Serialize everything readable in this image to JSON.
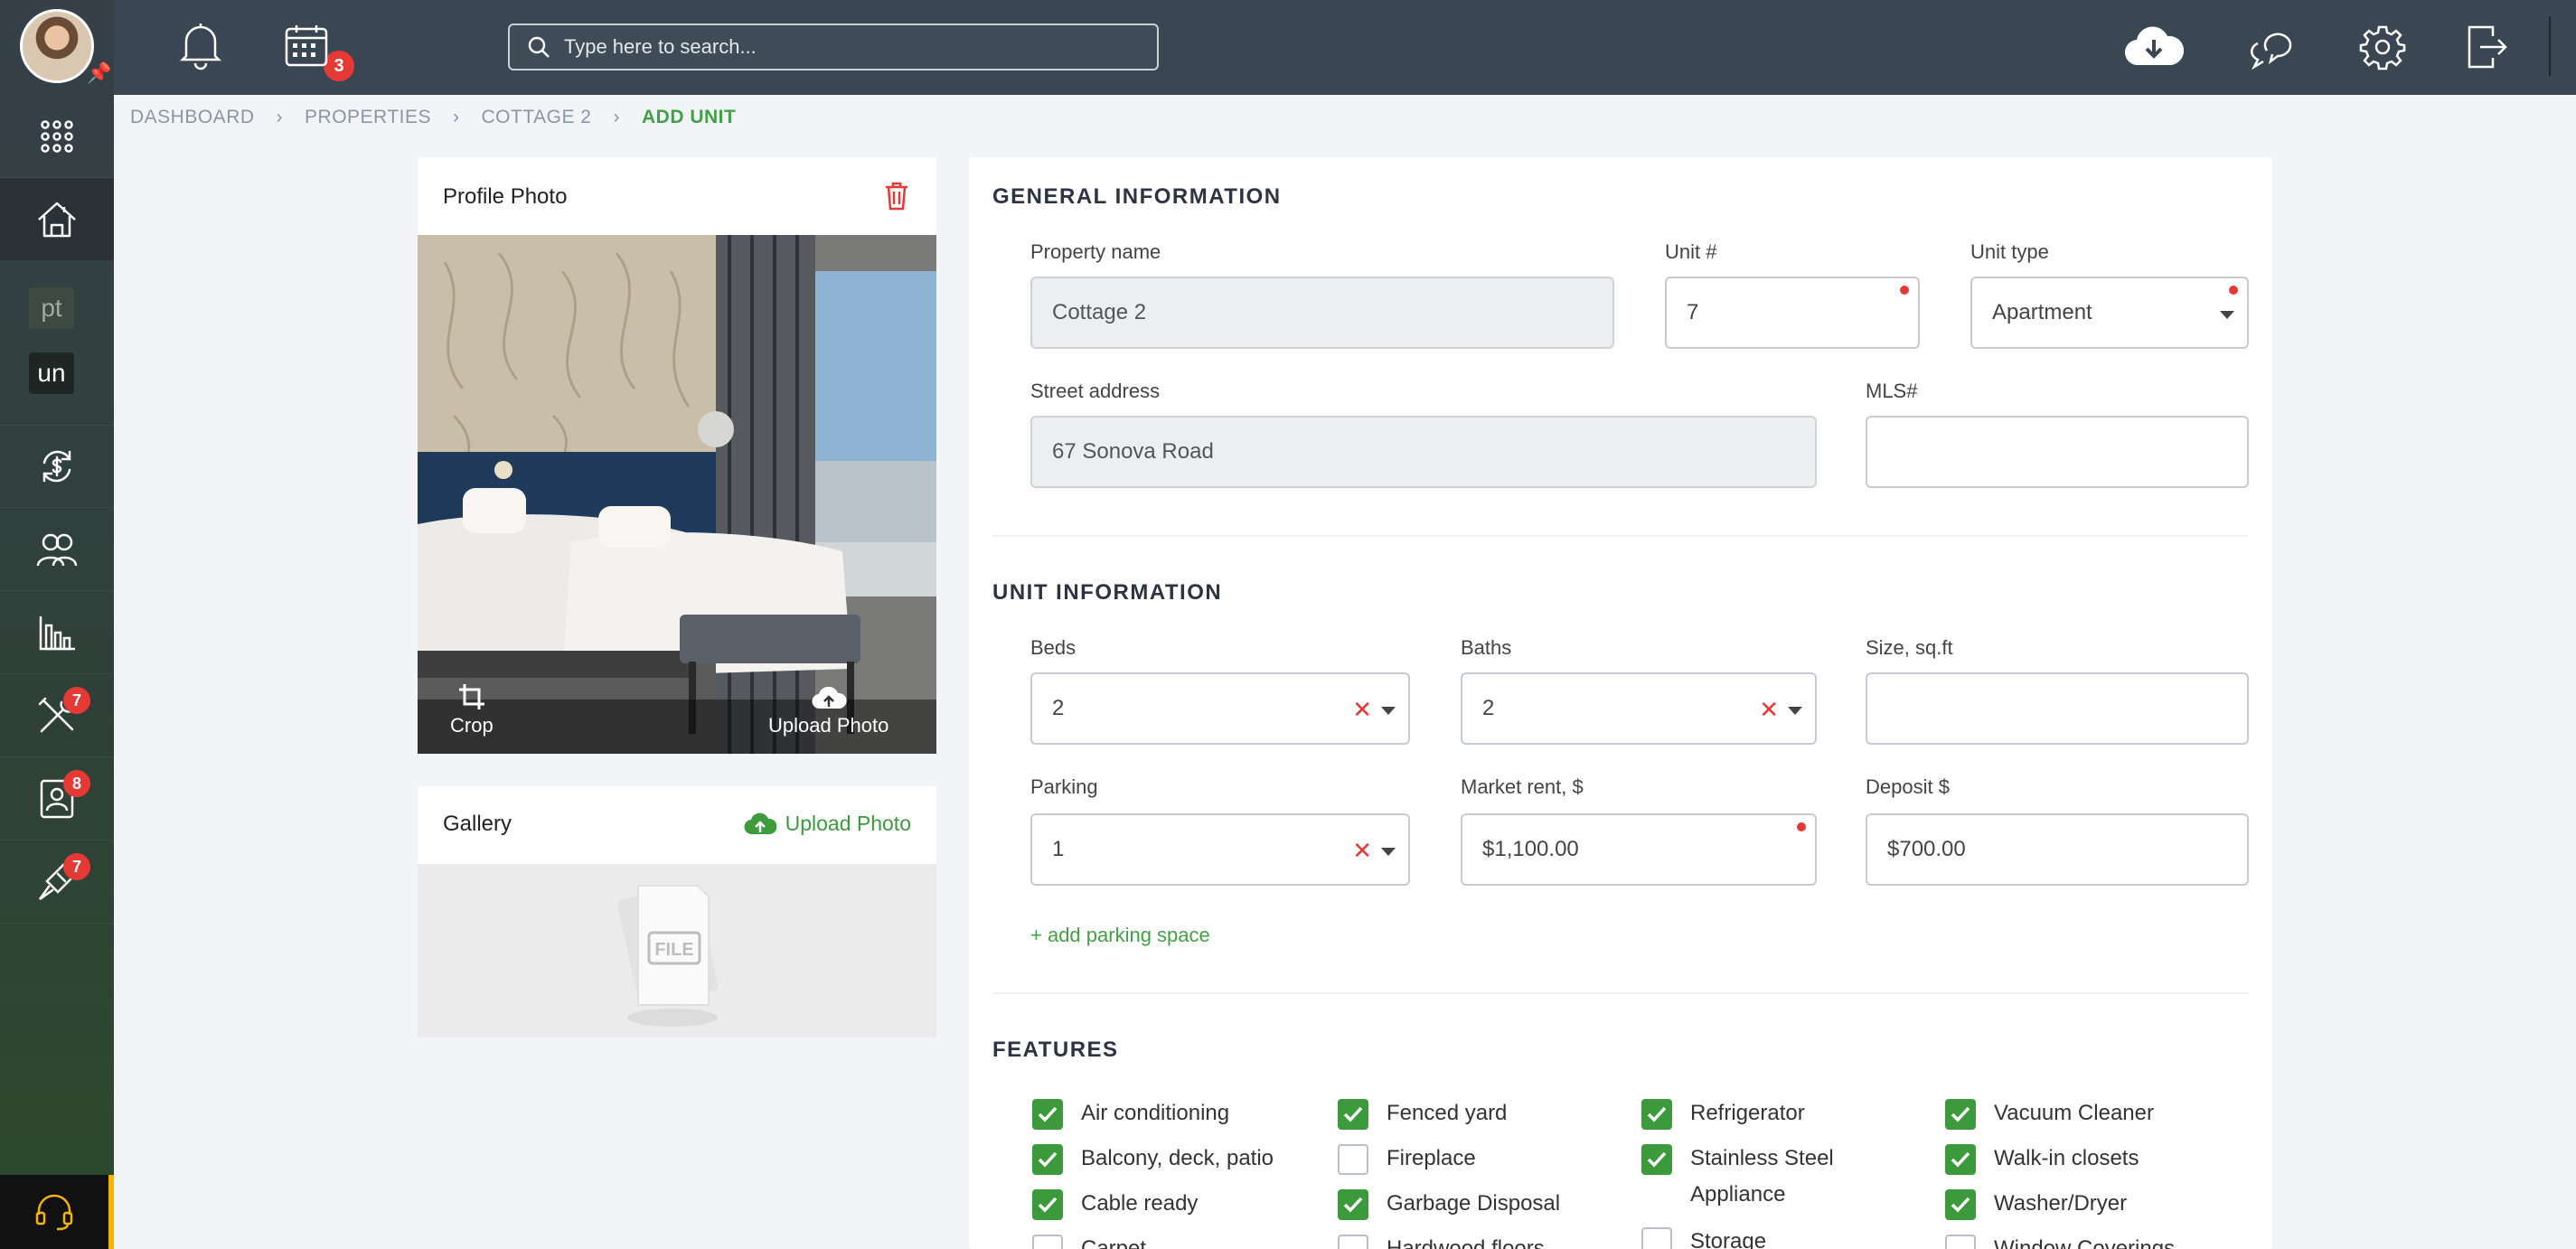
{
  "topbar": {
    "notifications_count": "3",
    "search_placeholder": "Type here to search..."
  },
  "sidebar": {
    "pt_label": "pt",
    "un_label": "un",
    "tools_badge": "7",
    "tenants_badge": "8",
    "maintenance_badge": "7"
  },
  "breadcrumb": [
    "DASHBOARD",
    "PROPERTIES",
    "COTTAGE 2",
    "ADD UNIT"
  ],
  "profile_photo": {
    "title": "Profile Photo",
    "crop_label": "Crop",
    "upload_label": "Upload Photo"
  },
  "gallery": {
    "title": "Gallery",
    "upload_label": "Upload Photo",
    "file_label": "FILE"
  },
  "general": {
    "title": "GENERAL INFORMATION",
    "property_name_label": "Property name",
    "property_name_value": "Cottage 2",
    "unit_label": "Unit #",
    "unit_value": "7",
    "unit_type_label": "Unit type",
    "unit_type_value": "Apartment",
    "street_label": "Street address",
    "street_value": "67 Sonova Road",
    "mls_label": "MLS#",
    "mls_value": ""
  },
  "unit_info": {
    "title": "UNIT INFORMATION",
    "beds_label": "Beds",
    "beds_value": "2",
    "baths_label": "Baths",
    "baths_value": "2",
    "size_label": "Size, sq.ft",
    "size_value": "",
    "parking_label": "Parking",
    "parking_value": "1",
    "rent_label": "Market rent, $",
    "rent_value": "$1,100.00",
    "deposit_label": "Deposit $",
    "deposit_value": "$700.00",
    "add_parking": "+ add parking space"
  },
  "features": {
    "title": "FEATURES",
    "col1": [
      {
        "label": "Air conditioning",
        "checked": true
      },
      {
        "label": "Balcony, deck, patio",
        "checked": true
      },
      {
        "label": "Cable ready",
        "checked": true
      },
      {
        "label": "Carpet",
        "checked": false
      }
    ],
    "col2": [
      {
        "label": "Fenced yard",
        "checked": true
      },
      {
        "label": "Fireplace",
        "checked": false
      },
      {
        "label": "Garbage Disposal",
        "checked": true
      },
      {
        "label": "Hardwood floors",
        "checked": false
      }
    ],
    "col3": [
      {
        "label": "Refrigerator",
        "checked": true
      },
      {
        "label": "Stainless Steel Appliance",
        "checked": true
      },
      {
        "label": "Storage",
        "checked": false
      }
    ],
    "col4": [
      {
        "label": "Vacuum Cleaner",
        "checked": true
      },
      {
        "label": "Walk-in closets",
        "checked": true
      },
      {
        "label": "Washer/Dryer",
        "checked": true
      },
      {
        "label": "Window Coverings",
        "checked": false
      }
    ]
  },
  "colors": {
    "accent_green": "#43a047",
    "badge_red": "#e53935",
    "topbar": "#3a4651"
  }
}
